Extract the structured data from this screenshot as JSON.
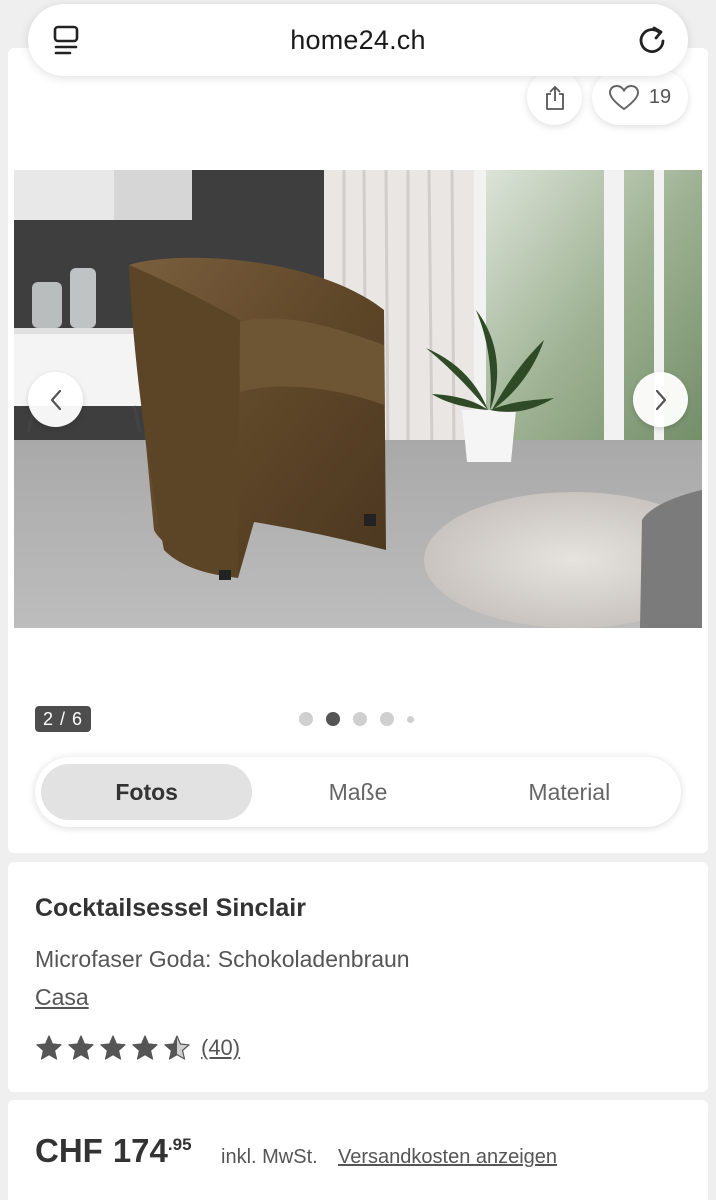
{
  "browser": {
    "url": "home24.ch"
  },
  "gallery": {
    "favorite_count": "19",
    "counter": "2 / 6",
    "total_dots": 5,
    "active_dot": 1,
    "tabs": [
      {
        "label": "Fotos",
        "active": true
      },
      {
        "label": "Maße",
        "active": false
      },
      {
        "label": "Material",
        "active": false
      }
    ]
  },
  "product": {
    "title": "Cocktailsessel Sinclair",
    "variant": "Microfaser Goda: Schokoladenbraun",
    "brand": "Casa",
    "rating": 4.5,
    "reviews": "(40)"
  },
  "price": {
    "currency": "CHF",
    "amount": "174",
    "cents": ".95",
    "vat": "inkl. MwSt.",
    "shipping_link": "Versandkosten anzeigen"
  },
  "colors": {
    "accent_dark": "#4d4d4d",
    "chair": "#6b5233",
    "background": "#efefef"
  }
}
